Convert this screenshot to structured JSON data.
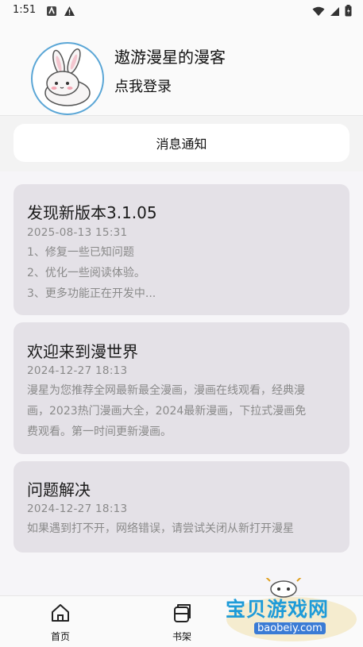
{
  "status_bar": {
    "time": "1:51"
  },
  "user": {
    "name": "遨游漫星的漫客",
    "login_prompt": "点我登录"
  },
  "notices_header": "消息通知",
  "notices": [
    {
      "title": "发现新版本3.1.05",
      "date": "2025-08-13 15:31",
      "lines": [
        "1、修复一些已知问题",
        "2、优化一些阅读体验。",
        "3、更多功能正在开发中..."
      ]
    },
    {
      "title": "欢迎来到漫世界",
      "date": "2024-12-27 18:13",
      "lines": [
        "漫星为您推荐全网最新最全漫画，漫画在线观看，经典漫",
        "画，2023热门漫画大全，2024最新漫画，下拉式漫画免",
        "费观看。第一时间更新漫画。"
      ]
    },
    {
      "title": "问题解决",
      "date": "2024-12-27 18:13",
      "lines": [
        "如果遇到打不开，网络错误，请尝试关闭从新打开漫星"
      ]
    }
  ],
  "bottom_nav": {
    "home": "首页",
    "bookshelf": "书架"
  },
  "watermark": {
    "brand": "宝贝游戏网",
    "url": "baobeiy.com"
  },
  "colors": {
    "card_bg": "#e4e1e7",
    "avatar_border": "#5aa6d6",
    "watermark_blue": "#1e9bd8"
  }
}
